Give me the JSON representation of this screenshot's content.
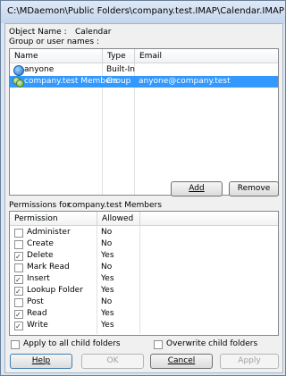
{
  "window": {
    "title": "C:\\MDaemon\\Public Folders\\company.test.IMAP\\Calendar.IMAP"
  },
  "object": {
    "label": "Object Name :",
    "value": "Calendar"
  },
  "group_label": "Group or user names :",
  "users_table": {
    "columns": [
      "Name",
      "Type",
      "Email"
    ],
    "rows": [
      {
        "name": "anyone",
        "type": "Built-In",
        "email": "",
        "icon": "user-icon",
        "selected": false
      },
      {
        "name": "company.test Members",
        "type": "Group",
        "email": "anyone@company.test",
        "icon": "group-icon",
        "selected": true
      }
    ]
  },
  "buttons": {
    "add": "Add",
    "remove": "Remove",
    "help": "Help",
    "ok": "OK",
    "cancel": "Cancel",
    "apply": "Apply"
  },
  "permissions_for": {
    "label": "Permissions for",
    "value": "company.test Members"
  },
  "permissions_table": {
    "columns": [
      "Permission",
      "Allowed"
    ],
    "rows": [
      {
        "name": "Administer",
        "allowed": "No",
        "checked": false
      },
      {
        "name": "Create",
        "allowed": "No",
        "checked": false
      },
      {
        "name": "Delete",
        "allowed": "Yes",
        "checked": true
      },
      {
        "name": "Mark Read",
        "allowed": "No",
        "checked": false
      },
      {
        "name": "Insert",
        "allowed": "Yes",
        "checked": true
      },
      {
        "name": "Lookup Folder",
        "allowed": "Yes",
        "checked": true
      },
      {
        "name": "Post",
        "allowed": "No",
        "checked": false
      },
      {
        "name": "Read",
        "allowed": "Yes",
        "checked": true
      },
      {
        "name": "Write",
        "allowed": "Yes",
        "checked": true
      }
    ]
  },
  "options": {
    "apply_children": "Apply to all child folders",
    "overwrite_children": "Overwrite child folders"
  }
}
